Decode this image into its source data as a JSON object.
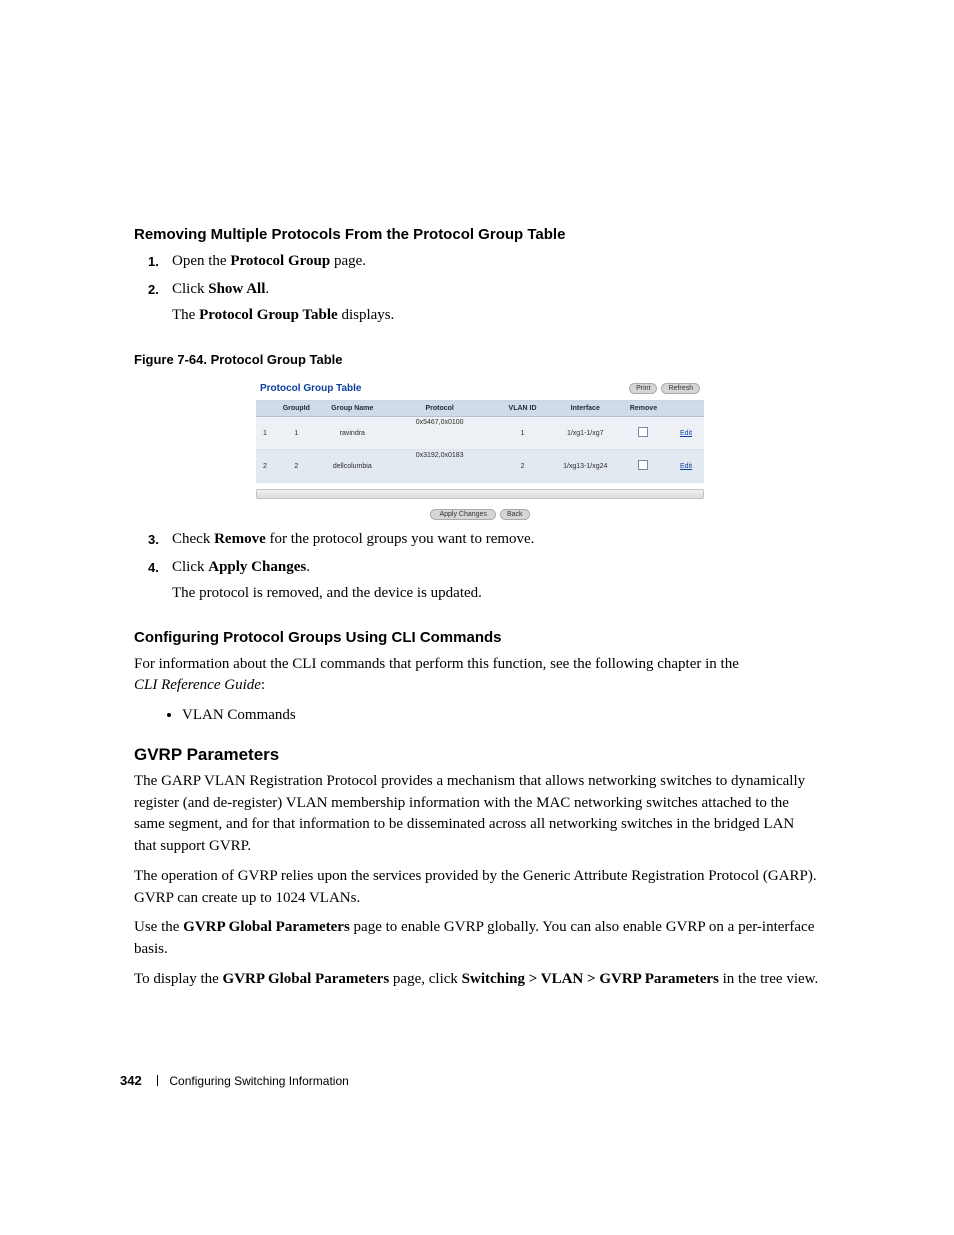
{
  "heading_remove": "Removing Multiple Protocols From the Protocol Group Table",
  "steps1": {
    "s1_a": "Open the ",
    "s1_b": "Protocol Group",
    "s1_c": " page.",
    "s2_a": "Click ",
    "s2_b": "Show All",
    "s2_c": ".",
    "s2sub_a": "The ",
    "s2sub_b": "Protocol Group Table",
    "s2sub_c": " displays."
  },
  "fig_caption": "Figure 7-64.    Protocol Group Table",
  "screenshot": {
    "title": "Protocol Group Table",
    "btn_print": "Print",
    "btn_refresh": "Refresh",
    "headers": {
      "idx": "",
      "gid": "GroupId",
      "gname": "Group Name",
      "proto": "Protocol",
      "vlan": "VLAN ID",
      "iface": "Interface",
      "remove": "Remove",
      "blank": ""
    },
    "rows": [
      {
        "idx": "1",
        "gid": "1",
        "gname": "ravindra",
        "proto": "0x5467,0x0100",
        "vlan": "1",
        "iface": "1/xg1-1/xg7",
        "edit": "Edit"
      },
      {
        "idx": "2",
        "gid": "2",
        "gname": "dellcolumbia",
        "proto": "0x3192,0x0183",
        "vlan": "2",
        "iface": "1/xg13-1/xg24",
        "edit": "Edit"
      }
    ],
    "apply": "Apply Changes",
    "back": "Back"
  },
  "steps2": {
    "s3_a": "Check ",
    "s3_b": "Remove",
    "s3_c": " for the protocol groups you want to remove.",
    "s4_a": "Click ",
    "s4_b": "Apply Changes",
    "s4_c": ".",
    "s4sub": "The protocol is removed, and the device is updated."
  },
  "heading_cli": "Configuring Protocol Groups Using CLI Commands",
  "cli_line": "For information about the CLI commands that perform this function, see the following chapter in the ",
  "cli_ref": "CLI Reference Guide",
  "cli_colon": ":",
  "cli_bullet": "VLAN Commands",
  "gvrp_heading": "GVRP Parameters",
  "gvrp_p1": "The GARP VLAN Registration Protocol provides a mechanism that allows networking switches to dynamically register (and de-register) VLAN membership information with the MAC networking switches attached to the same segment, and for that information to be disseminated across all networking switches in the bridged LAN that support GVRP.",
  "gvrp_p2": "The operation of GVRP relies upon the services provided by the Generic Attribute Registration Protocol (GARP). GVRP can create up to 1024 VLANs.",
  "gvrp_p3_a": "Use the ",
  "gvrp_p3_b": "GVRP Global Parameters",
  "gvrp_p3_c": " page to enable GVRP globally. You can also enable GVRP on a per-interface basis.",
  "gvrp_p4_a": "To display the ",
  "gvrp_p4_b": "GVRP Global Parameters",
  "gvrp_p4_c": " page, click ",
  "gvrp_p4_d": "Switching > VLAN > GVRP Parameters",
  "gvrp_p4_e": " in the tree view.",
  "footer_page": "342",
  "footer_text": "Configuring Switching Information"
}
